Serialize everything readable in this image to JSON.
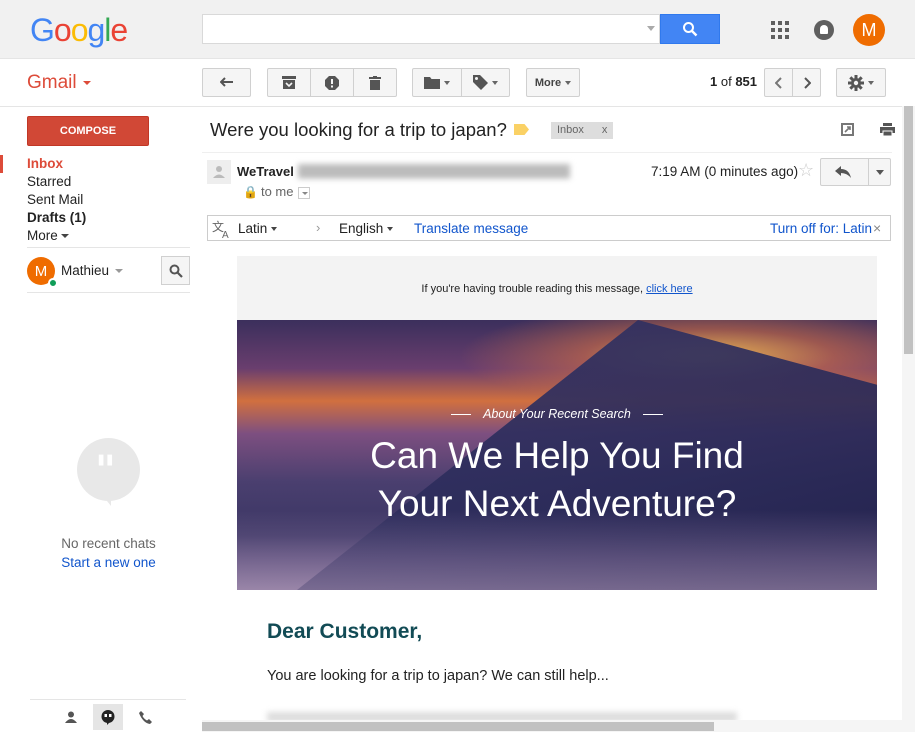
{
  "header": {
    "logo_letters": [
      "G",
      "o",
      "o",
      "g",
      "l",
      "e"
    ],
    "search_value": "",
    "avatar_letter": "M"
  },
  "toolbar": {
    "app_label": "Gmail",
    "more_label": "More",
    "pager_current": "1",
    "pager_of": "of",
    "pager_total": "851"
  },
  "sidebar": {
    "compose_label": "COMPOSE",
    "items": [
      {
        "label": "Inbox",
        "state": "active"
      },
      {
        "label": "Starred"
      },
      {
        "label": "Sent Mail"
      },
      {
        "label": "Drafts (1)",
        "state": "bold"
      },
      {
        "label": "More"
      }
    ],
    "chat_user": {
      "name": "Mathieu",
      "avatar_letter": "M",
      "status": "online"
    },
    "no_chats_text": "No recent chats",
    "new_chat_link": "Start a new one"
  },
  "message": {
    "subject": "Were you looking for a trip to japan?",
    "label_chip": "Inbox",
    "label_chip_close": "x",
    "sender_name": "WeTravel",
    "recipient": "to me",
    "timestamp": "7:19 AM (0 minutes ago)"
  },
  "translate_bar": {
    "from_language": "Latin",
    "to_language": "English",
    "translate_link": "Translate message",
    "turn_off_link": "Turn off for: Latin"
  },
  "email_body": {
    "trouble_text": "If you're having trouble reading this message,",
    "trouble_link": "click here",
    "hero_kicker": "About Your Recent Search",
    "hero_title_line1": "Can We Help You Find",
    "hero_title_line2": "Your Next Adventure?",
    "greeting": "Dear Customer,",
    "intro": "You are looking for a trip to japan? We can still help..."
  },
  "colors": {
    "gmail_red": "#dd4b39",
    "compose_red": "#d14836",
    "search_blue": "#4285f4",
    "link_blue": "#1155cc",
    "avatar_orange": "#ef6c00",
    "greeting_teal": "#124b55",
    "label_yellow": "#fad165"
  }
}
